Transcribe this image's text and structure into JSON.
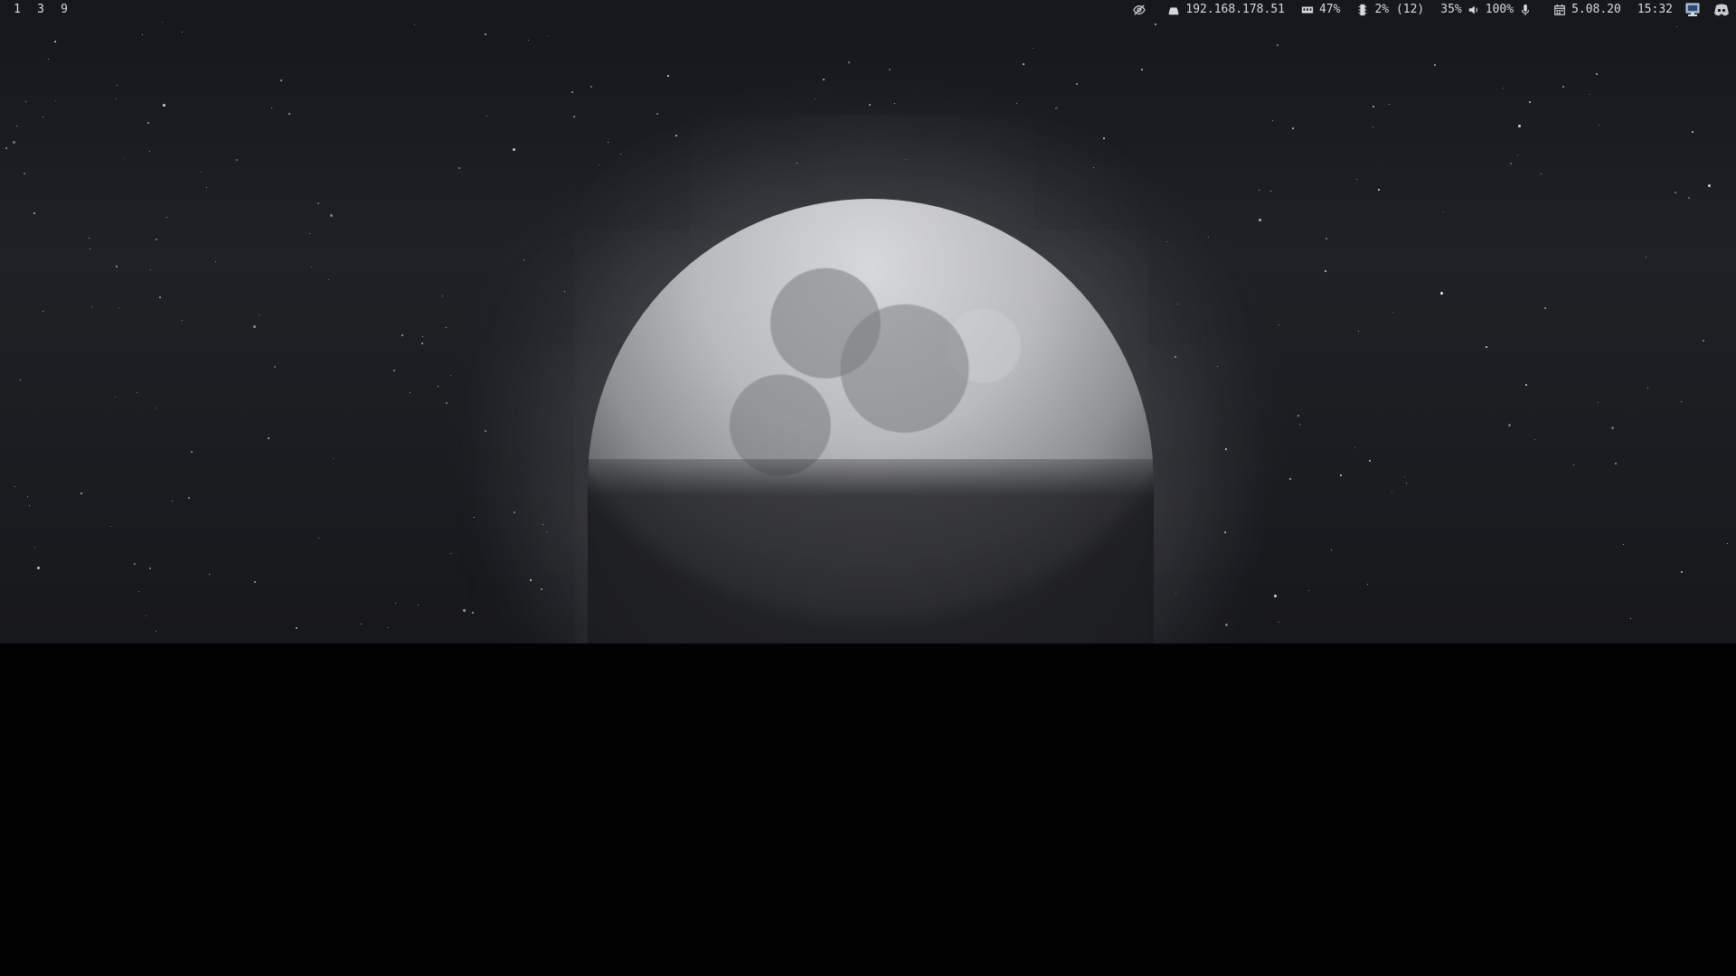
{
  "workspaces": [
    "1",
    "3",
    "9"
  ],
  "status": {
    "network_ip": "192.168.178.51",
    "memory": "47%",
    "cpu": "2% (12)",
    "brightness": "35%",
    "volume": "100%",
    "date": "5.08.20",
    "time": "15:32"
  },
  "icons": {
    "hidden": "eye-off-icon",
    "network": "network-icon",
    "memory": "memory-icon",
    "cpu": "cpu-icon",
    "volume": "speaker-icon",
    "mic": "microphone-icon",
    "calendar": "calendar-icon",
    "tray_display": "display-tray-icon",
    "tray_discord": "discord-tray-icon"
  },
  "colors": {
    "bar_text": "#d7dae0",
    "discord": "#c8cbd2",
    "display_tray": "#8ea6c8"
  }
}
